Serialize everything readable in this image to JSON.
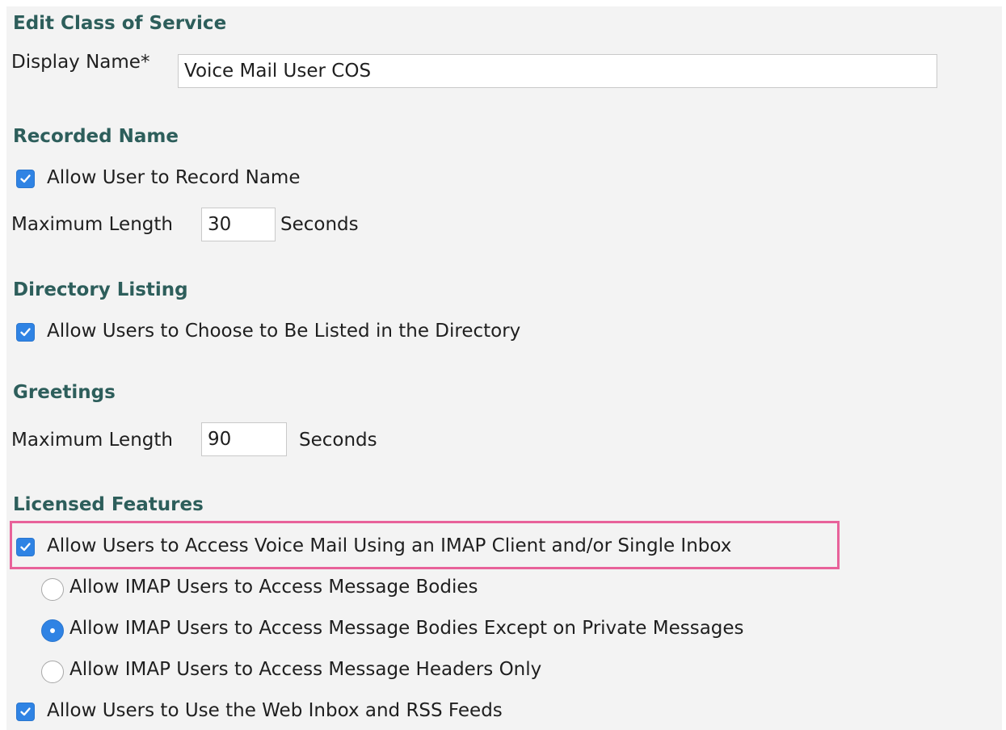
{
  "title": "Edit Class of Service",
  "display_name": {
    "label": "Display Name*",
    "value": "Voice Mail User COS"
  },
  "recorded_name": {
    "heading": "Recorded Name",
    "allow_record": {
      "label": "Allow User to Record Name",
      "checked": true
    },
    "max_length": {
      "label": "Maximum Length",
      "value": "30",
      "unit": "Seconds"
    }
  },
  "directory_listing": {
    "heading": "Directory Listing",
    "allow_listed": {
      "label": "Allow Users to Choose to Be Listed in the Directory",
      "checked": true
    }
  },
  "greetings": {
    "heading": "Greetings",
    "max_length": {
      "label": "Maximum Length",
      "value": "90",
      "unit": "Seconds"
    }
  },
  "licensed_features": {
    "heading": "Licensed Features",
    "imap_access": {
      "label": "Allow Users to Access Voice Mail Using an IMAP Client and/or Single Inbox",
      "checked": true
    },
    "imap_options": [
      {
        "label": "Allow IMAP Users to Access Message Bodies",
        "selected": false
      },
      {
        "label": "Allow IMAP Users to Access Message Bodies Except on Private Messages",
        "selected": true
      },
      {
        "label": "Allow IMAP Users to Access Message Headers Only",
        "selected": false
      }
    ],
    "web_inbox": {
      "label": "Allow Users to Use the Web Inbox and RSS Feeds",
      "checked": true
    }
  },
  "colors": {
    "heading": "#2d5e5b",
    "accent": "#2f83e4",
    "highlight": "#e8629a",
    "panel": "#f3f3f3"
  }
}
